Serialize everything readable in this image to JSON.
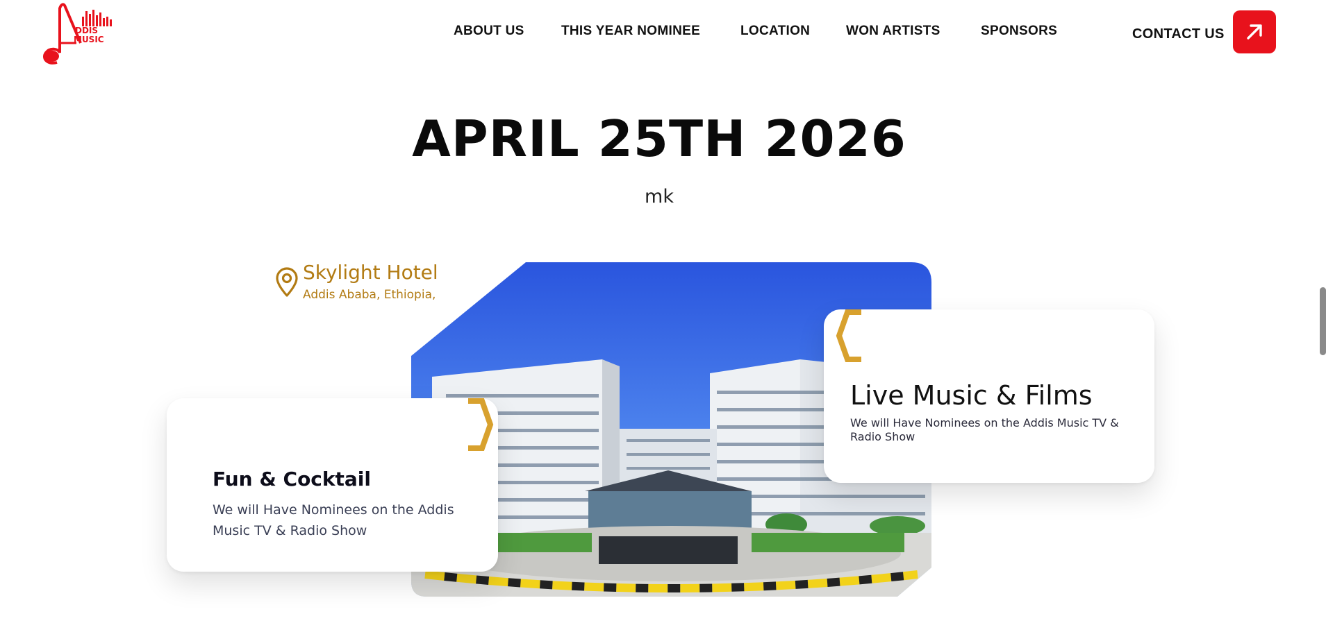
{
  "brand": {
    "logo_alt": "Addis Music",
    "logo_line1": "DDIS",
    "logo_line2": "MUSIC",
    "color": "#e8121c"
  },
  "nav": {
    "items": [
      {
        "label": "ABOUT US"
      },
      {
        "label": "THIS YEAR NOMINEE"
      },
      {
        "label": "LOCATION"
      },
      {
        "label": "WON ARTISTS"
      },
      {
        "label": "SPONSORS"
      }
    ],
    "contact_label": "CONTACT US",
    "contact_icon": "arrow-up-right-icon"
  },
  "hero": {
    "date": "APRIL 25TH 2026",
    "subtitle": "mk"
  },
  "location": {
    "venue": "Skylight Hotel",
    "city": "Addis Ababa, Ethiopia,",
    "accent_color": "#b27b13"
  },
  "cards": {
    "left": {
      "title": "Fun & Cocktail",
      "text": "We will Have Nominees on the Addis Music TV & Radio Show"
    },
    "right": {
      "title": "Live Music & Films",
      "text": "We will Have Nominees on the Addis Music TV & Radio Show"
    }
  },
  "colors": {
    "accent_red": "#e8121c",
    "gold": "#d8a12e",
    "sky": "#2f5fe0"
  }
}
